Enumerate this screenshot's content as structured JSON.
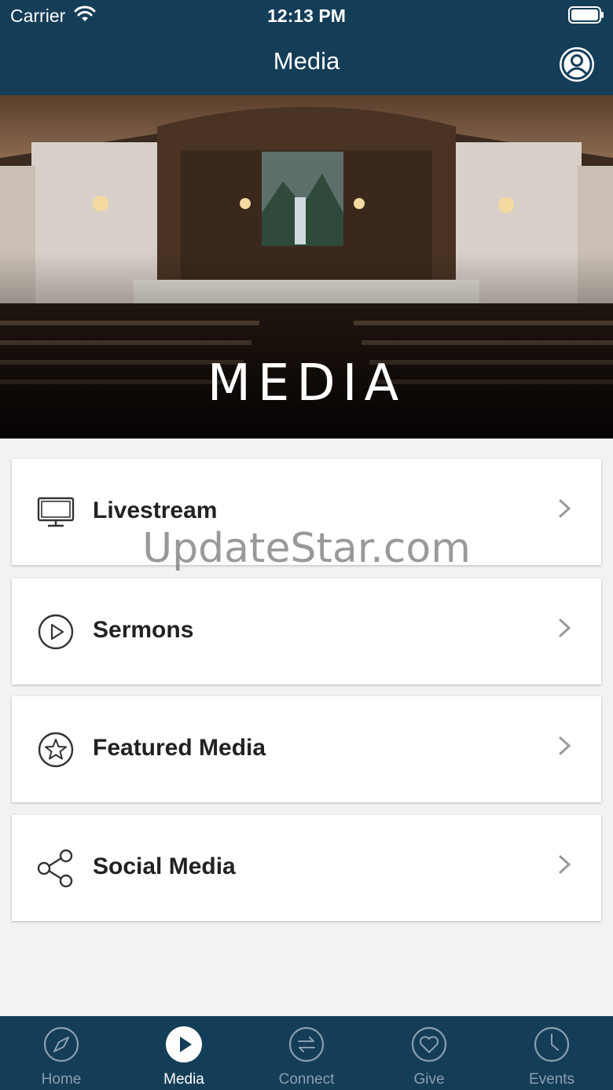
{
  "status_bar": {
    "carrier": "Carrier",
    "time": "12:13 PM"
  },
  "nav": {
    "title": "Media",
    "profile_icon": "user-circle-icon"
  },
  "hero": {
    "title": "MEDIA"
  },
  "menu": [
    {
      "label": "Livestream",
      "icon": "monitor-icon"
    },
    {
      "label": "Sermons",
      "icon": "play-circle-icon"
    },
    {
      "label": "Featured Media",
      "icon": "star-circle-icon"
    },
    {
      "label": "Social Media",
      "icon": "share-icon"
    }
  ],
  "watermark": "UpdateStar.com",
  "tabs": [
    {
      "label": "Home",
      "icon": "compass-icon",
      "active": false
    },
    {
      "label": "Media",
      "icon": "play-icon",
      "active": true
    },
    {
      "label": "Connect",
      "icon": "exchange-icon",
      "active": false
    },
    {
      "label": "Give",
      "icon": "heart-icon",
      "active": false
    },
    {
      "label": "Events",
      "icon": "clock-icon",
      "active": false
    }
  ],
  "colors": {
    "bar": "#143d58",
    "inactive_tab": "#8aa0b0",
    "active_tab": "#ffffff"
  }
}
